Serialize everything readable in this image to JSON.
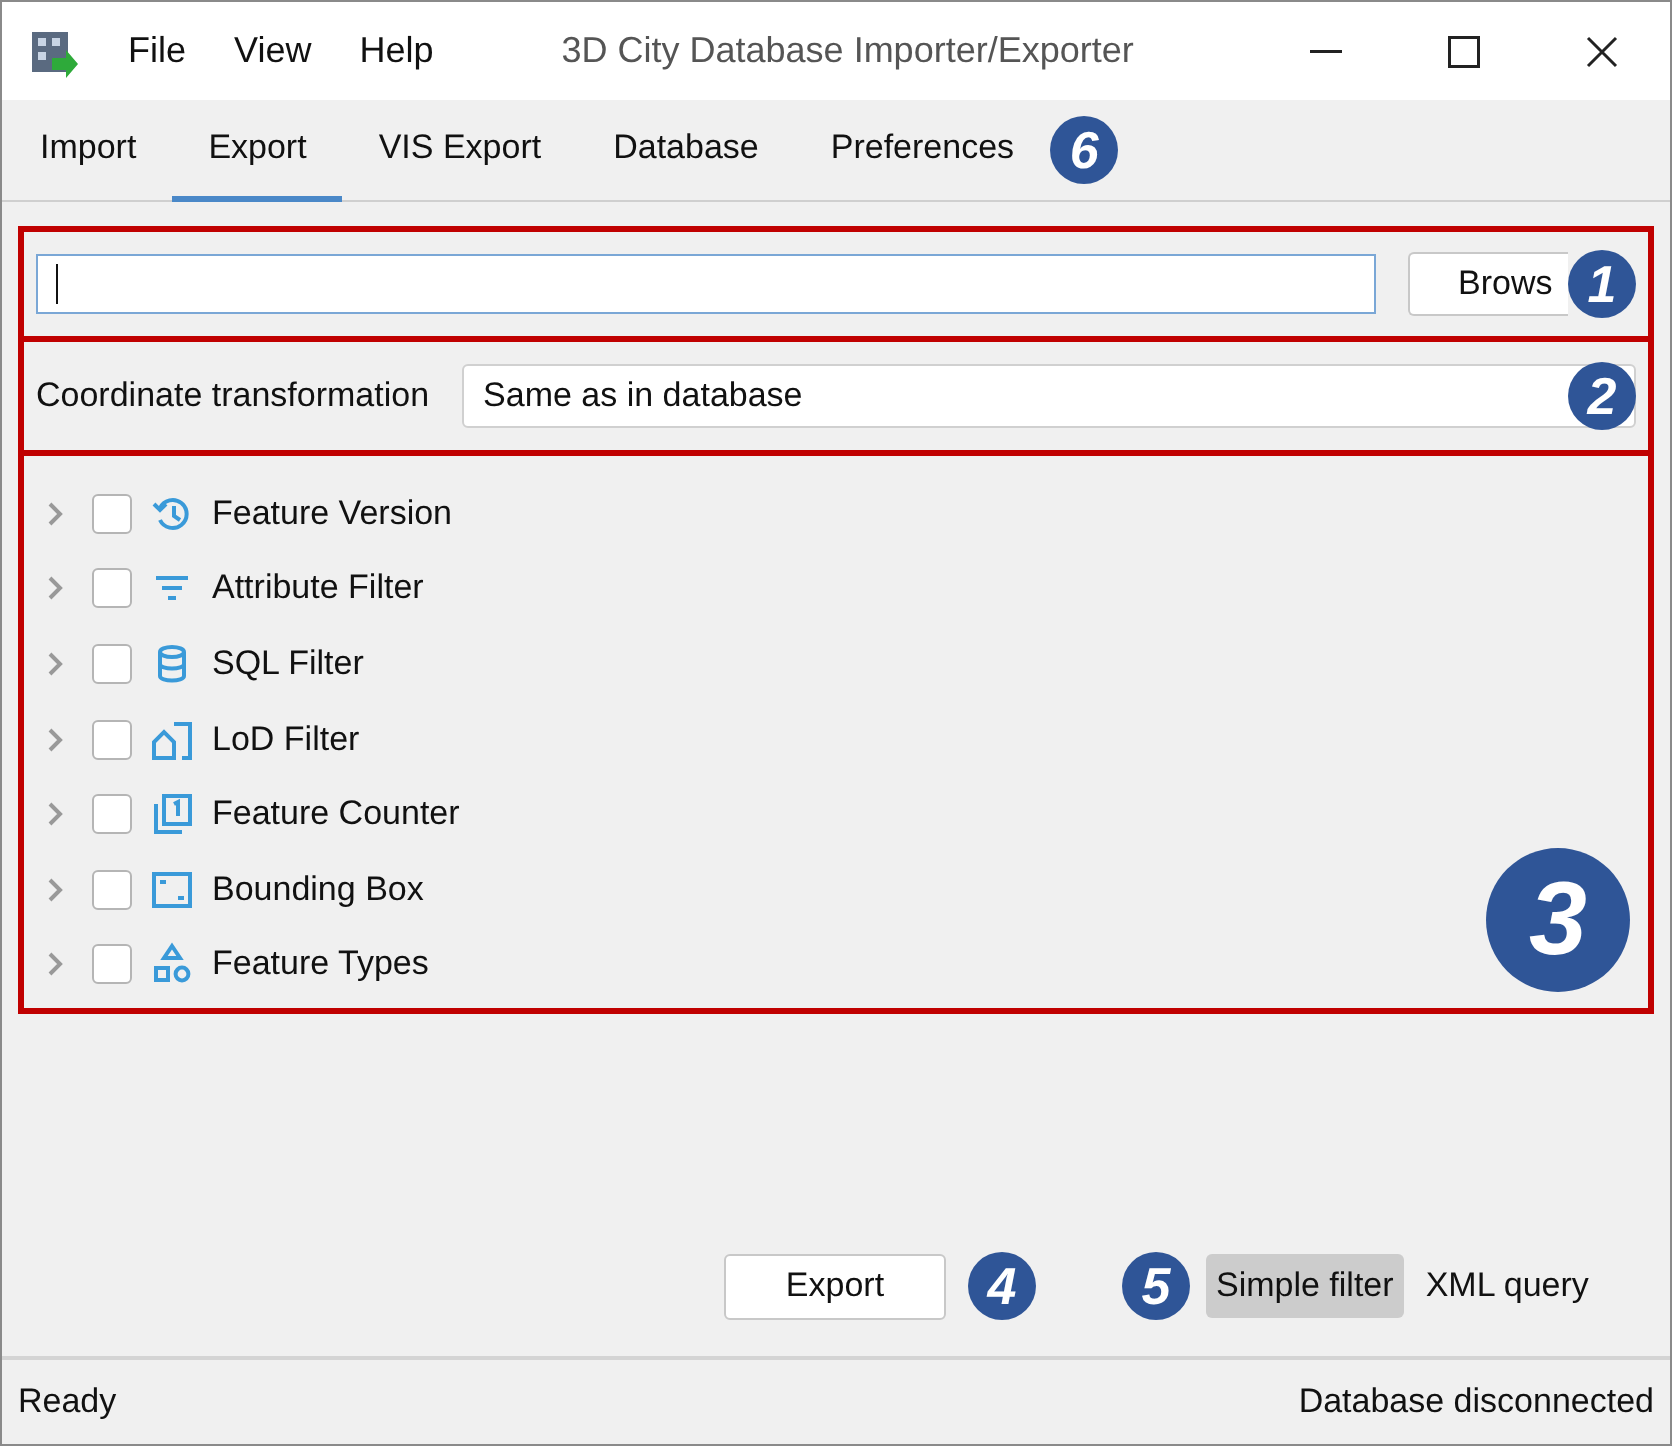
{
  "window": {
    "title": "3D City Database Importer/Exporter",
    "menu": [
      "File",
      "View",
      "Help"
    ]
  },
  "tabs": [
    {
      "label": "Import",
      "selected": false
    },
    {
      "label": "Export",
      "selected": true
    },
    {
      "label": "VIS Export",
      "selected": false
    },
    {
      "label": "Database",
      "selected": false
    },
    {
      "label": "Preferences",
      "selected": false
    }
  ],
  "tabs_badge": "6",
  "output_row": {
    "browse_button": "Brows",
    "badge": "1"
  },
  "coordinate_row": {
    "label": "Coordinate transformation",
    "value": "Same as in database",
    "badge": "2"
  },
  "filters": {
    "badge": "3",
    "items": [
      {
        "label": "Feature Version",
        "kind": "history",
        "checked": false,
        "expanded": false
      },
      {
        "label": "Attribute Filter",
        "kind": "filter",
        "checked": false,
        "expanded": false
      },
      {
        "label": "SQL Filter",
        "kind": "database",
        "checked": false,
        "expanded": false
      },
      {
        "label": "LoD Filter",
        "kind": "lod",
        "checked": false,
        "expanded": false
      },
      {
        "label": "Feature Counter",
        "kind": "counter",
        "checked": false,
        "expanded": false
      },
      {
        "label": "Bounding Box",
        "kind": "bbox",
        "checked": false,
        "expanded": false
      },
      {
        "label": "Feature Types",
        "kind": "types",
        "checked": false,
        "expanded": false
      }
    ]
  },
  "export_button": "Export",
  "export_badge": "4",
  "query_mode": {
    "badge": "5",
    "options": [
      {
        "label": "Simple filter",
        "selected": true
      },
      {
        "label": "XML query",
        "selected": false
      }
    ]
  },
  "status_bar": {
    "left": "Ready",
    "right": "Database disconnected"
  }
}
